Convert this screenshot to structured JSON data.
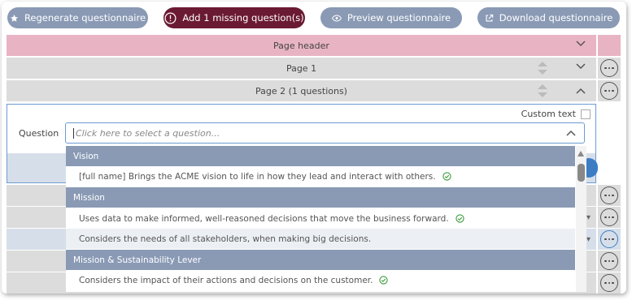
{
  "toolbar": {
    "regenerate_label": "Regenerate questionnaire",
    "add_missing_label": "Add 1 missing question(s)",
    "preview_label": "Preview questionnaire",
    "download_label": "Download questionnaire"
  },
  "rows": {
    "page_header": "Page header",
    "page1": "Page 1",
    "page2": "Page 2 (1 questions)"
  },
  "panel": {
    "custom_text_label": "Custom text",
    "question_label": "Question",
    "placeholder": "Click here to select a question..."
  },
  "dropdown": {
    "groups": [
      {
        "label": "Vision",
        "options": [
          {
            "text": "[full name] Brings the ACME vision to life in how they lead and interact with others.",
            "checked": true
          }
        ]
      },
      {
        "label": "Mission",
        "options": [
          {
            "text": "Uses data to make informed, well-reasoned decisions that move the business forward.",
            "checked": true
          },
          {
            "text": "Considers the needs of all stakeholders, when making big decisions.",
            "checked": false
          }
        ]
      },
      {
        "label": "Mission & Sustainability Lever",
        "options": [
          {
            "text": "Considers the impact of their actions and decisions on the customer.",
            "checked": true
          }
        ]
      }
    ]
  },
  "colors": {
    "accent_dark": "#6b1a33",
    "button_gray": "#8a9ab5",
    "header_pink": "#e8b4c4",
    "check_green": "#3a9a3a",
    "focus_blue": "#6c9bd2"
  },
  "icons": [
    "star-icon",
    "exclamation-circle-icon",
    "eye-icon",
    "external-link-icon",
    "chevron-down-icon",
    "chevron-up-icon",
    "more-dots-icon",
    "sort-arrows-icon",
    "check-circle-icon"
  ]
}
